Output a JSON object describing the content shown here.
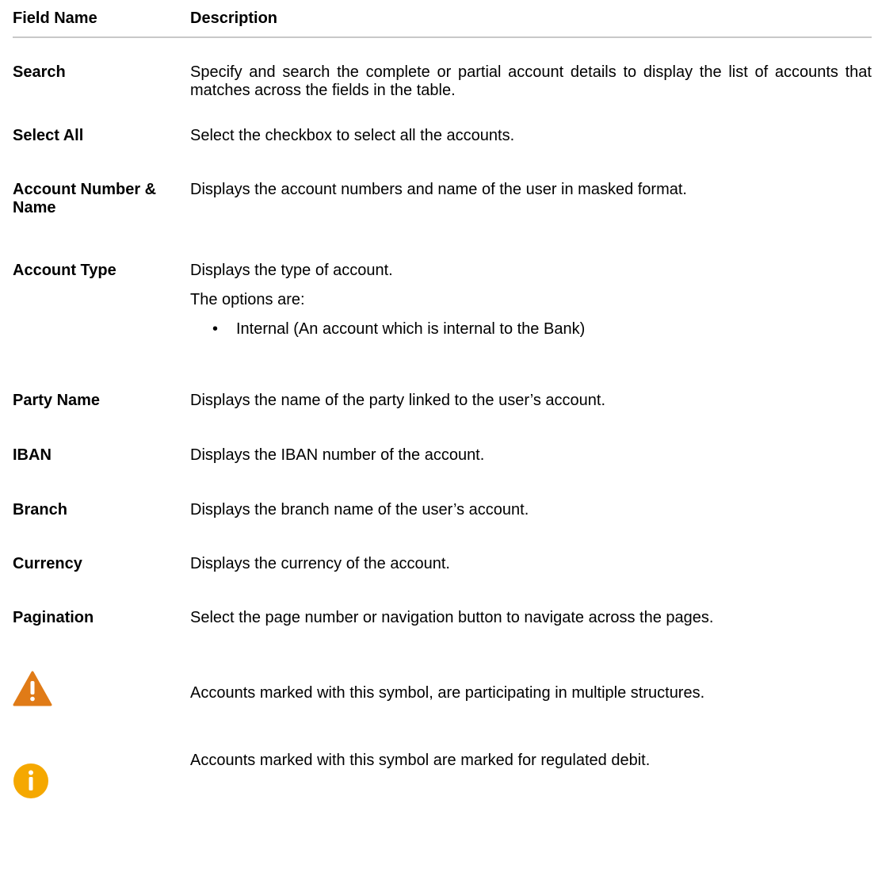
{
  "table": {
    "headers": [
      "Field Name",
      "Description"
    ],
    "rows": [
      {
        "field": "Search",
        "description": "Specify and search the complete or partial account details to display the list of accounts that matches across the fields in the table."
      },
      {
        "field": "Select All",
        "description": "Select the checkbox to select all the accounts."
      },
      {
        "field": "Account Number & Name",
        "description": "Displays the account numbers and name of the user in masked format."
      },
      {
        "field": "Account Type",
        "description": "Displays the type of account.",
        "sub_text": "The options are:",
        "options": [
          "Internal (An account which is internal to the Bank)"
        ]
      },
      {
        "field": "Party Name",
        "description": "Displays the name of the party linked to the user’s account."
      },
      {
        "field": "IBAN",
        "description": "Displays the IBAN number of the account."
      },
      {
        "field": "Branch",
        "description": "Displays the branch name of the user’s account."
      },
      {
        "field": "Currency",
        "description": "Displays the currency of the account."
      },
      {
        "field": "Pagination",
        "description": "Select the page number or navigation button to navigate across the pages."
      }
    ],
    "icon_rows": [
      {
        "icon": "warning-triangle-icon",
        "color": "#e07b17",
        "description": "Accounts marked with this symbol, are participating in multiple structures."
      },
      {
        "icon": "info-circle-icon",
        "color": "#f5a800",
        "description": "Accounts marked with this symbol are marked for regulated debit."
      }
    ]
  }
}
